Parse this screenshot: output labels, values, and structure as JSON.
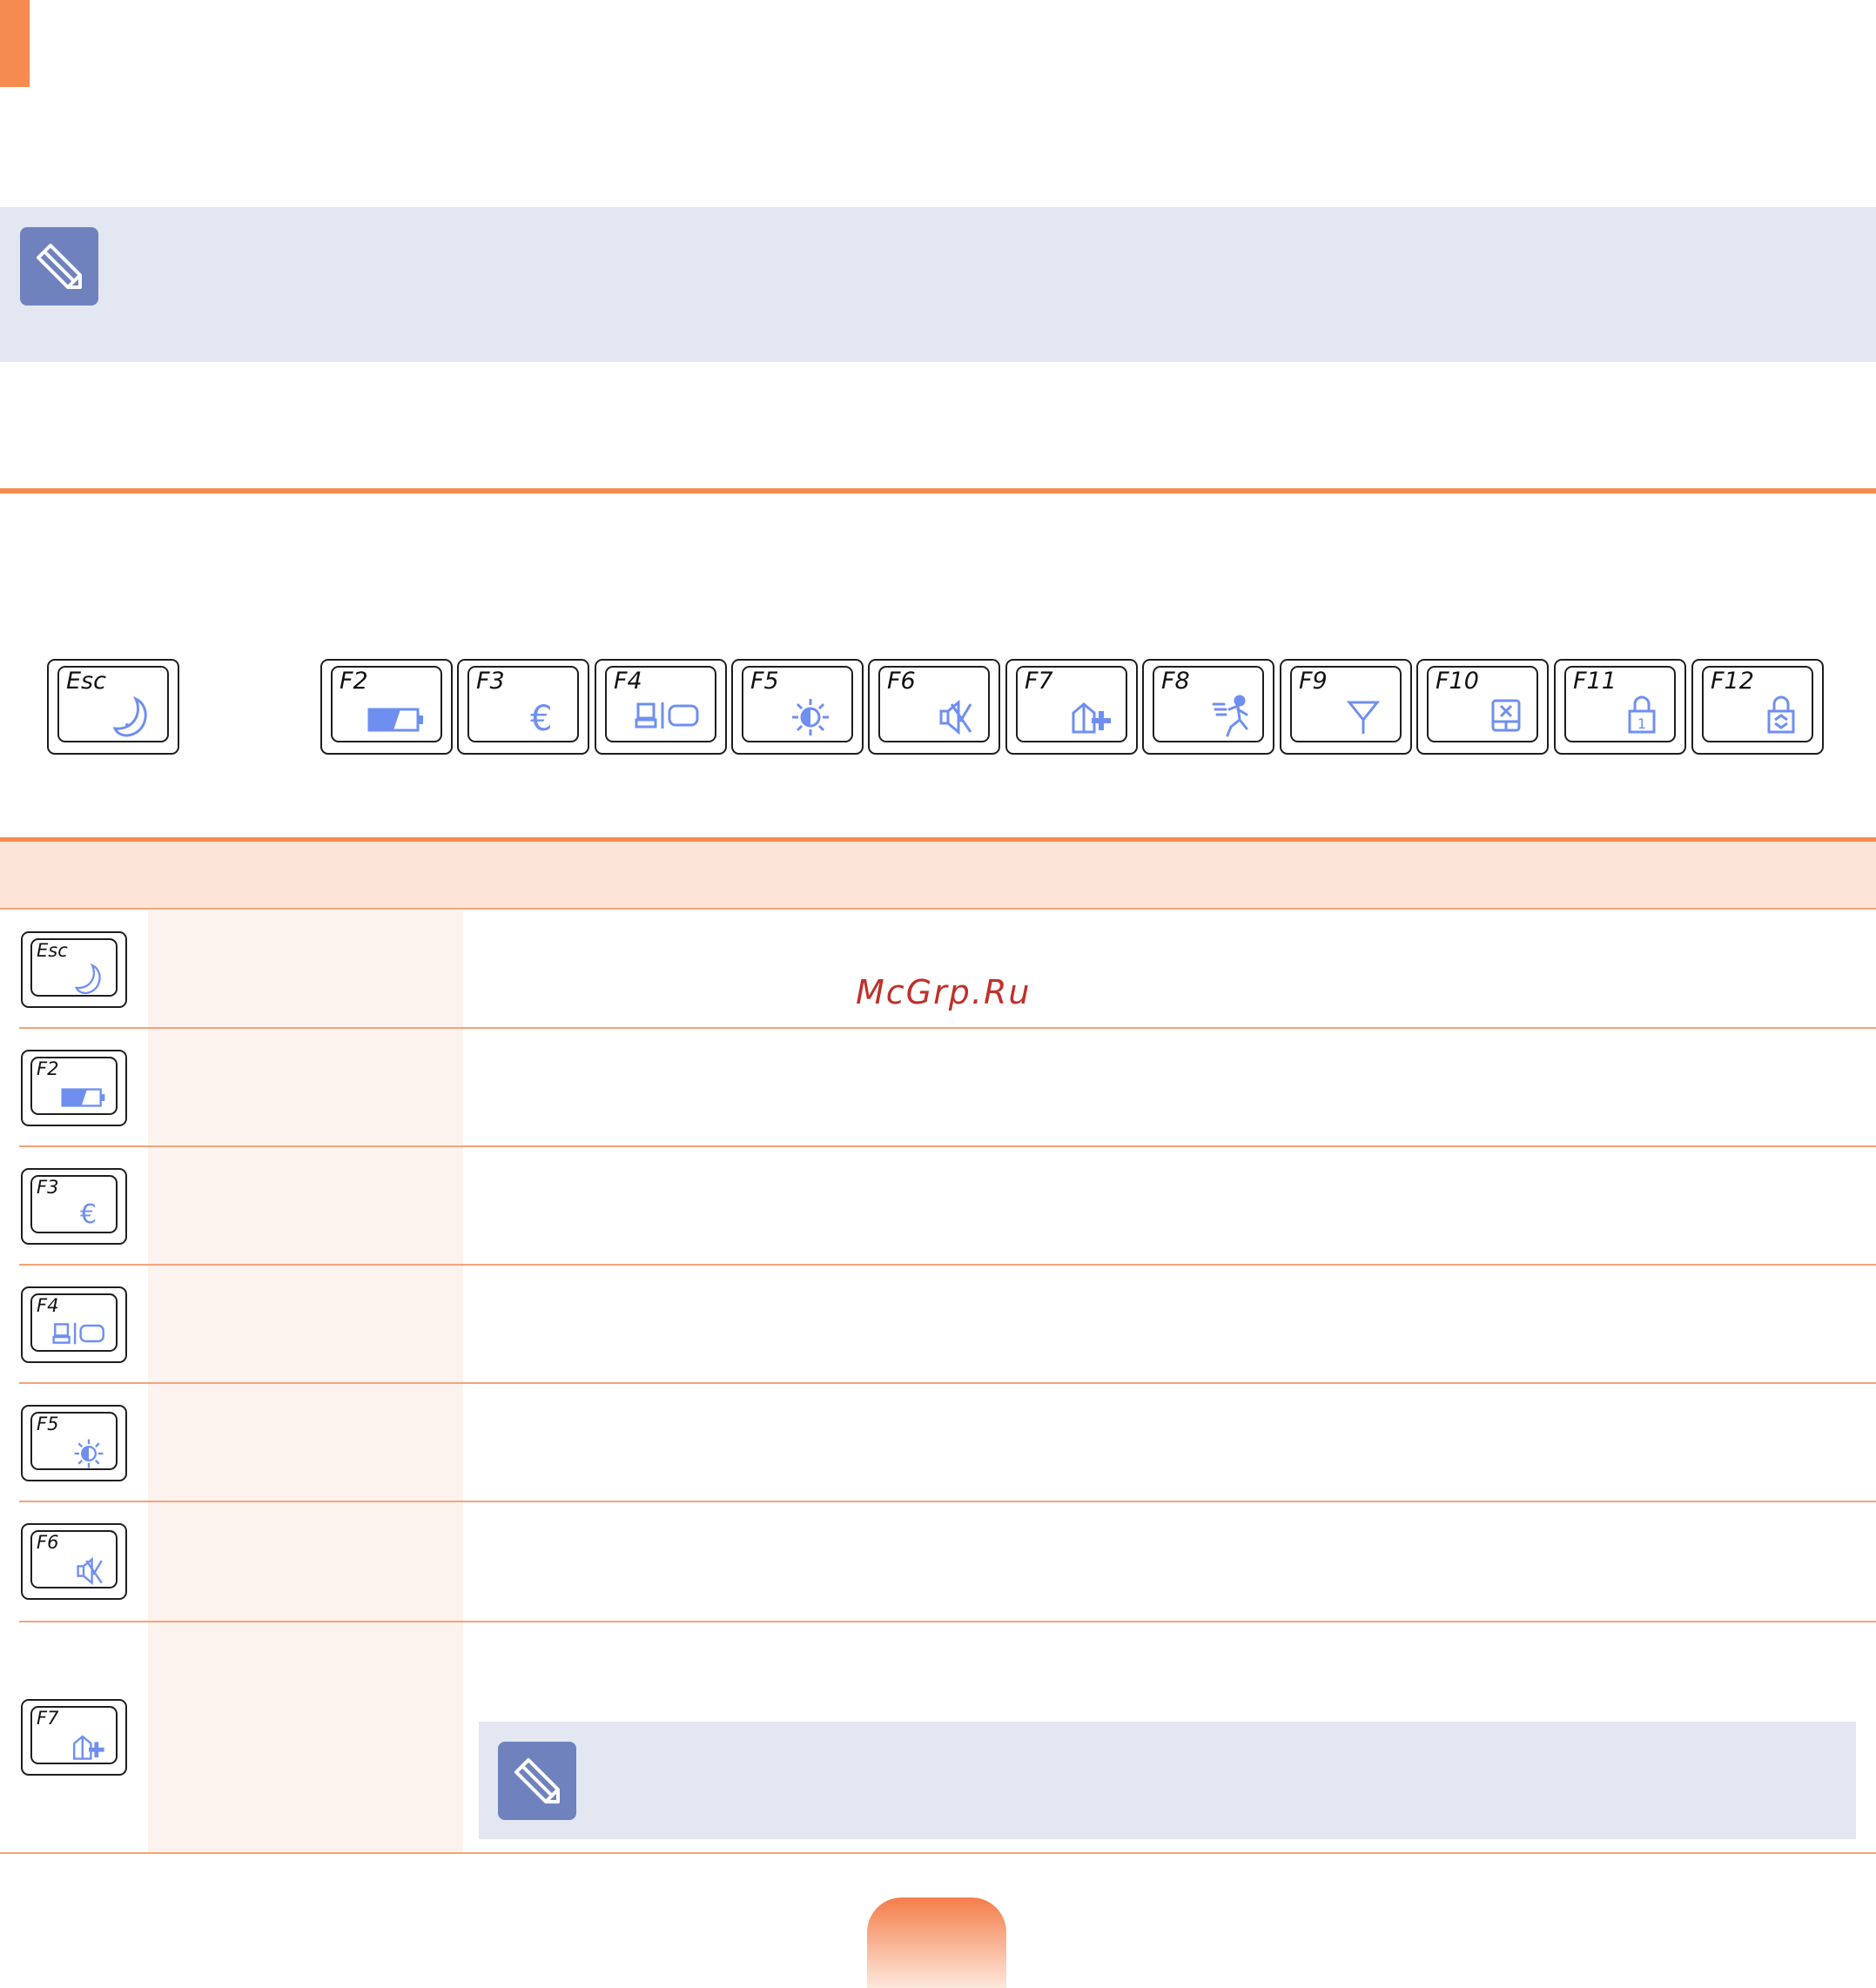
{
  "keys": {
    "esc": "Esc",
    "f2": "F2",
    "f3": "F3",
    "f4": "F4",
    "f5": "F5",
    "f6": "F6",
    "f7": "F7",
    "f8": "F8",
    "f9": "F9",
    "f10": "F10",
    "f11": "F11",
    "f12": "F12"
  },
  "key_icons": {
    "esc": "moon-icon",
    "f2": "battery-icon",
    "f3": "euro-icon",
    "f4": "display-switch-icon",
    "f5": "brightness-icon",
    "f6": "mute-icon",
    "f7": "program-add-icon",
    "f8": "running-man-icon",
    "f9": "antenna-icon",
    "f10": "touchpad-off-icon",
    "f11": "num-lock-icon",
    "f12": "scroll-lock-icon"
  },
  "table_keys": [
    "Esc",
    "F2",
    "F3",
    "F4",
    "F5",
    "F6",
    "F7"
  ],
  "watermark": "McGrp.Ru",
  "colors": {
    "accent": "#f68b4f",
    "icon_blue": "#6f8ff0",
    "note_bg": "#e2e7f2",
    "note_icon": "#6f82bd",
    "watermark": "#c0302a"
  }
}
